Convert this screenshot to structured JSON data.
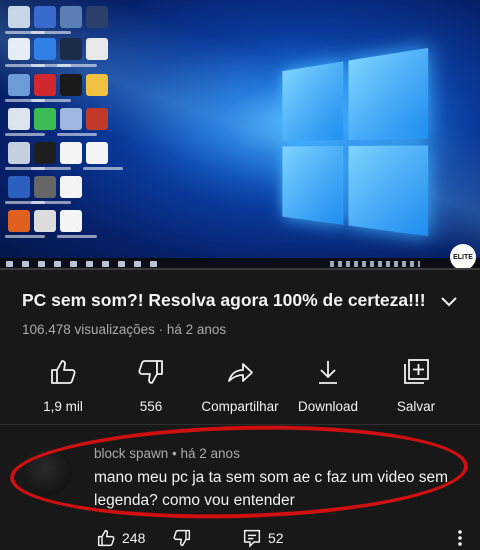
{
  "video": {
    "progress": 0.0,
    "channel_badge_text": "ELITE"
  },
  "info": {
    "title": "PC sem som?! Resolva agora 100% de certeza!!!",
    "meta": "106.478 visualizações · há 2 anos"
  },
  "actions": [
    {
      "icon": "thumbs-up-icon",
      "label": "1,9 mil"
    },
    {
      "icon": "thumbs-down-icon",
      "label": "556"
    },
    {
      "icon": "share-icon",
      "label": "Compartilhar"
    },
    {
      "icon": "download-icon",
      "label": "Download"
    },
    {
      "icon": "save-to-playlist-icon",
      "label": "Salvar"
    }
  ],
  "comment": {
    "author_line": "block spawn • há 2 anos",
    "text": "mano meu pc ja ta sem som ae c faz um video sem legenda? como vou entender",
    "likes": "248",
    "replies": "52"
  },
  "colors": {
    "background": "#181818",
    "accent": "#ff0000",
    "highlight_ellipse": "#d01010",
    "secondary_text": "#aaaaaa"
  }
}
